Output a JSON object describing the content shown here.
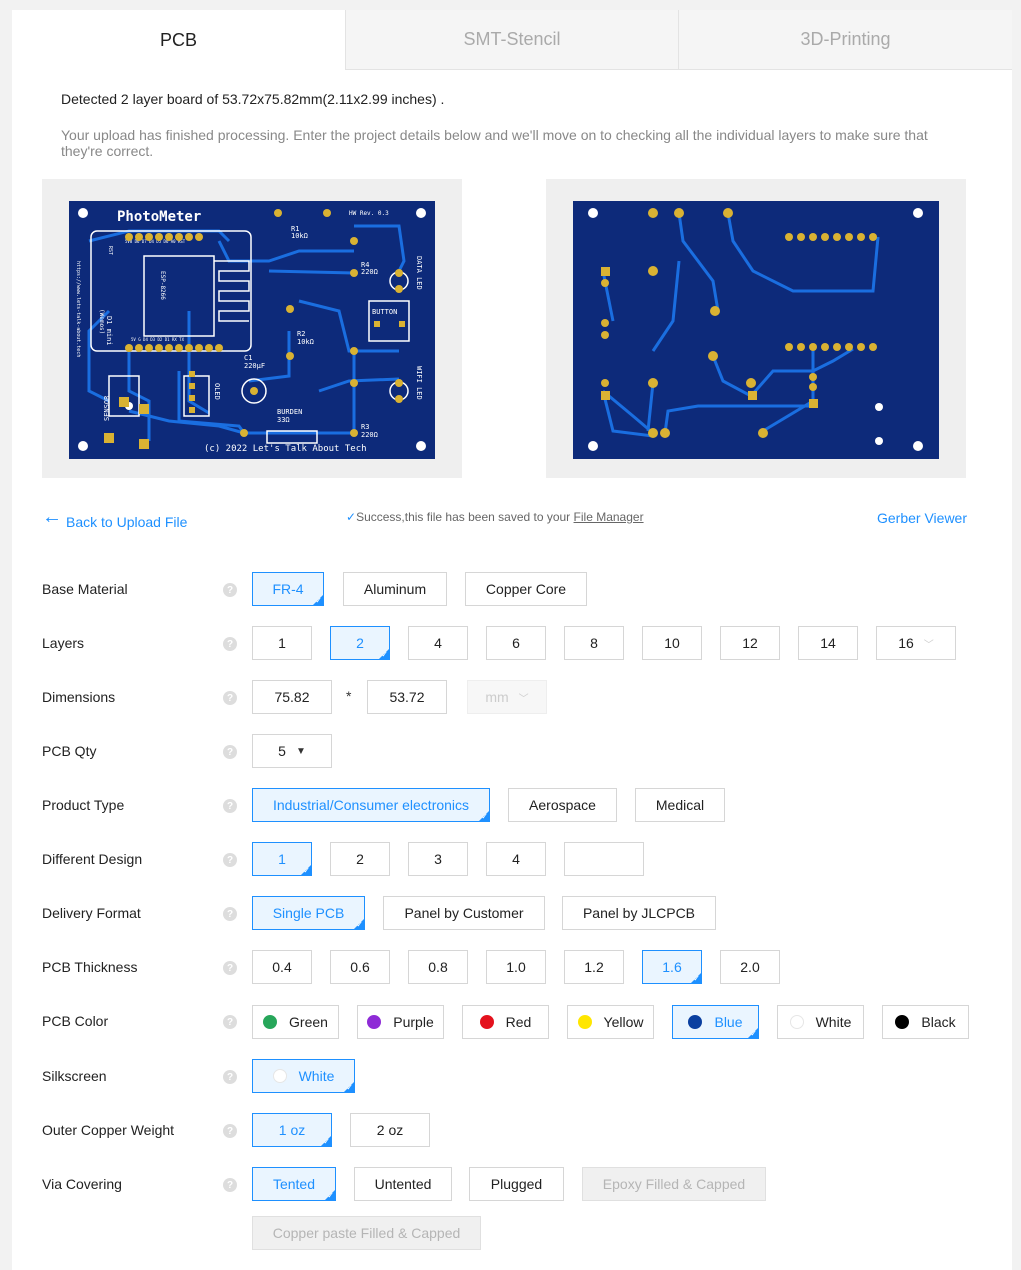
{
  "tabs": [
    {
      "label": "PCB",
      "active": true
    },
    {
      "label": "SMT-Stencil",
      "active": false
    },
    {
      "label": "3D-Printing",
      "active": false
    }
  ],
  "detected_text": "Detected 2 layer board of 53.72x75.82mm(2.11x2.99 inches) .",
  "processing_text": "Your upload has finished processing. Enter the project details below and we'll move on to checking all the individual layers to make sure that they're correct.",
  "board_preview": {
    "board_color": "#0d2a7a",
    "trace_color": "#1a6ee0",
    "pad_color": "#d9b233",
    "silk_color": "#ffffff",
    "top_title": "PhotoMeter",
    "top_version": "HW Rev. 0.3",
    "top_copyright": "(c) 2022 Let's Talk About Tech",
    "labels": {
      "r1": "R1",
      "r1v": "10kΩ",
      "r2": "R2",
      "r2v": "10kΩ",
      "r3": "R3",
      "r3v": "220Ω",
      "r4": "R4",
      "r4v": "220Ω",
      "c1": "C1",
      "c1v": "220µF",
      "burden": "BURDEN",
      "burdenv": "33Ω",
      "button": "BUTTON",
      "data_led": "DATA LED",
      "wifi_led": "WIFI LED",
      "sensor": "SENSOR",
      "oled": "OLED",
      "d1": "D1 mini",
      "esp": "ESP-8266",
      "url": "https://www.lets-talk-about.tech",
      "rst": "RST",
      "d1w": "(Wemos)",
      "pins_top": "5V8 D6 D7 D4 D5 D6 A0 RST",
      "pins_bottom": "5V G D4 D3 D2 D1 RX TX"
    }
  },
  "links": {
    "back": "Back to Upload File",
    "success_prefix": "Success,this file has been saved to your",
    "file_manager": "File Manager",
    "gerber_viewer": "Gerber Viewer"
  },
  "help_icon": "?",
  "form": {
    "base_material": {
      "label": "Base Material",
      "options": [
        "FR-4",
        "Aluminum",
        "Copper Core"
      ],
      "selected": "FR-4"
    },
    "layers": {
      "label": "Layers",
      "options": [
        "1",
        "2",
        "4",
        "6",
        "8",
        "10",
        "12",
        "14",
        "16"
      ],
      "selected": "2"
    },
    "dimensions": {
      "label": "Dimensions",
      "width": "75.82",
      "separator": "*",
      "height": "53.72",
      "unit": "mm"
    },
    "pcb_qty": {
      "label": "PCB Qty",
      "value": "5"
    },
    "product_type": {
      "label": "Product Type",
      "options": [
        "Industrial/Consumer electronics",
        "Aerospace",
        "Medical"
      ],
      "selected": "Industrial/Consumer electronics"
    },
    "different_design": {
      "label": "Different Design",
      "options": [
        "1",
        "2",
        "3",
        "4",
        ""
      ],
      "selected": "1"
    },
    "delivery_format": {
      "label": "Delivery Format",
      "options": [
        "Single PCB",
        "Panel by Customer",
        "Panel by JLCPCB"
      ],
      "selected": "Single PCB"
    },
    "pcb_thickness": {
      "label": "PCB Thickness",
      "options": [
        "0.4",
        "0.6",
        "0.8",
        "1.0",
        "1.2",
        "1.6",
        "2.0"
      ],
      "selected": "1.6"
    },
    "pcb_color": {
      "label": "PCB Color",
      "options": [
        {
          "name": "Green",
          "color": "#27a65a"
        },
        {
          "name": "Purple",
          "color": "#8e2bd6"
        },
        {
          "name": "Red",
          "color": "#e4121d"
        },
        {
          "name": "Yellow",
          "color": "#ffe600"
        },
        {
          "name": "Blue",
          "color": "#0a3fa0"
        },
        {
          "name": "White",
          "color": "#ffffff"
        },
        {
          "name": "Black",
          "color": "#000000"
        }
      ],
      "selected": "Blue"
    },
    "silkscreen": {
      "label": "Silkscreen",
      "options": [
        {
          "name": "White",
          "color": "#ffffff"
        }
      ],
      "selected": "White"
    },
    "outer_copper_weight": {
      "label": "Outer Copper Weight",
      "options": [
        "1 oz",
        "2 oz"
      ],
      "selected": "1 oz"
    },
    "via_covering": {
      "label": "Via Covering",
      "options": [
        "Tented",
        "Untented",
        "Plugged",
        "Epoxy Filled & Capped",
        "Copper paste Filled & Capped"
      ],
      "selected": "Tented",
      "disabled": [
        "Epoxy Filled & Capped",
        "Copper paste Filled & Capped"
      ]
    }
  }
}
